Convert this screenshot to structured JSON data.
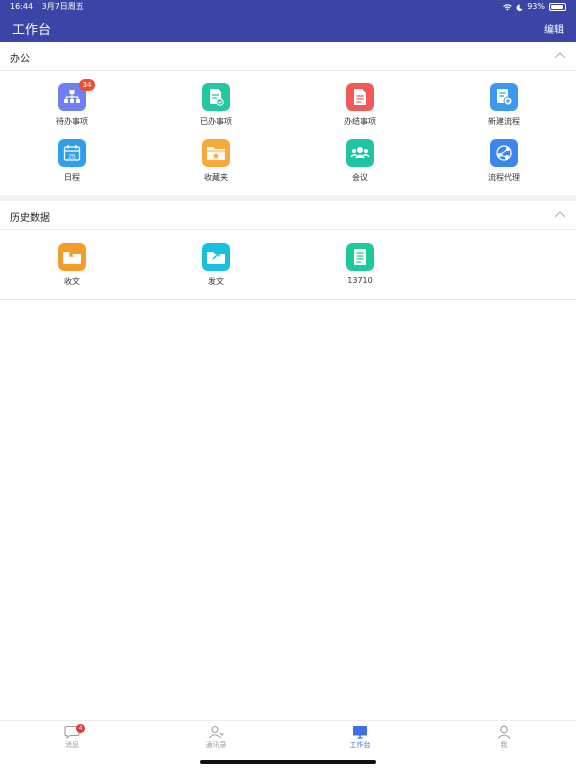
{
  "status_bar": {
    "time": "16:44",
    "date": "3月7日周五",
    "battery": "93%"
  },
  "header": {
    "title": "工作台",
    "edit_label": "编辑"
  },
  "sections": [
    {
      "title": "办公",
      "items": [
        {
          "label": "待办事项",
          "icon": "org-chart-icon",
          "color": "#6f7ef0",
          "badge": "34"
        },
        {
          "label": "已办事项",
          "icon": "doc-check-icon",
          "color": "#24c7a0"
        },
        {
          "label": "办结事项",
          "icon": "doc-icon",
          "color": "#f25a5a"
        },
        {
          "label": "新建流程",
          "icon": "new-flow-icon",
          "color": "#3b9af0"
        },
        {
          "label": "日程",
          "icon": "calendar-icon",
          "color": "#2e9fe8",
          "calendar_day": "25"
        },
        {
          "label": "收藏夹",
          "icon": "folder-star-icon",
          "color": "#f7a93a"
        },
        {
          "label": "会议",
          "icon": "meeting-icon",
          "color": "#1fc4a4"
        },
        {
          "label": "流程代理",
          "icon": "share-flow-icon",
          "color": "#3d86ec"
        }
      ]
    },
    {
      "title": "历史数据",
      "items": [
        {
          "label": "收文",
          "icon": "inbox-folder-icon",
          "color": "#f59c2b"
        },
        {
          "label": "发文",
          "icon": "send-folder-icon",
          "color": "#19bfe0"
        },
        {
          "label": "13710",
          "icon": "document-list-icon",
          "color": "#1ec99a"
        }
      ]
    }
  ],
  "tabbar": {
    "items": [
      {
        "label": "消息",
        "icon": "message-icon",
        "badge": "4"
      },
      {
        "label": "通讯录",
        "icon": "contacts-icon"
      },
      {
        "label": "工作台",
        "icon": "workbench-icon",
        "active": true
      },
      {
        "label": "我",
        "icon": "profile-icon"
      }
    ]
  },
  "colors": {
    "header_bg": "#3b45a5",
    "active_tab": "#3d6fe0",
    "badge_red": "#ef4d2e"
  }
}
